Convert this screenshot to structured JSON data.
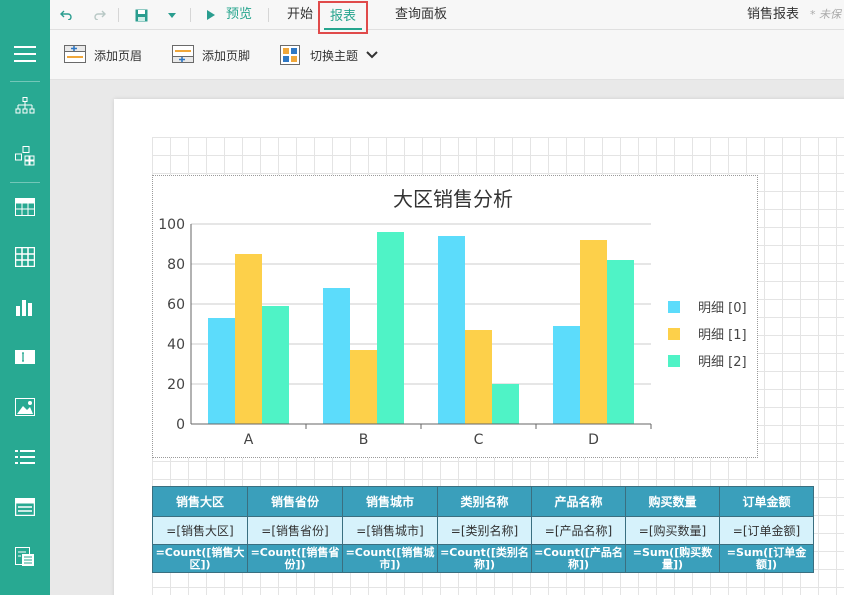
{
  "topbar": {
    "tabs": {
      "preview": "预览",
      "start": "开始",
      "report": "报表",
      "query_panel": "查询面板"
    },
    "doc_title": "销售报表",
    "unsaved": "* 未保"
  },
  "ribbon": {
    "add_header": "添加页眉",
    "add_footer": "添加页脚",
    "switch_theme": "切换主题"
  },
  "sidebar": {
    "items": [
      "menu-icon",
      "data-source-icon",
      "dataset-icon",
      "table-icon",
      "grid-icon",
      "chart-icon",
      "textbox-icon",
      "image-icon",
      "list-icon",
      "container-icon",
      "subreport-icon"
    ]
  },
  "chart_data": {
    "type": "bar",
    "title": "大区销售分析",
    "categories": [
      "A",
      "B",
      "C",
      "D"
    ],
    "series": [
      {
        "name": "明细 [0]",
        "values": [
          53,
          68,
          94,
          49
        ],
        "color": "#5cdcfb"
      },
      {
        "name": "明细 [1]",
        "values": [
          85,
          37,
          47,
          92
        ],
        "color": "#fdd04a"
      },
      {
        "name": "明细 [2]",
        "values": [
          59,
          96,
          20,
          82
        ],
        "color": "#4ff3c6"
      }
    ],
    "ylim": [
      0,
      100
    ],
    "yticks": [
      "0",
      "20",
      "40",
      "60",
      "80",
      "100"
    ],
    "grid": true,
    "legend": "right"
  },
  "table": {
    "headers": [
      "销售大区",
      "销售省份",
      "销售城市",
      "类别名称",
      "产品名称",
      "购买数量",
      "订单金额"
    ],
    "detail": [
      "=[销售大区]",
      "=[销售省份]",
      "=[销售城市]",
      "=[类别名称]",
      "=[产品名称]",
      "=[购买数量]",
      "=[订单金额]"
    ],
    "aggregate": [
      "=Count([销售大区])",
      "=Count([销售省份])",
      "=Count([销售城市])",
      "=Count([类别名称])",
      "=Count([产品名称])",
      "=Sum([购买数量])",
      "=Sum([订单金额])"
    ]
  }
}
